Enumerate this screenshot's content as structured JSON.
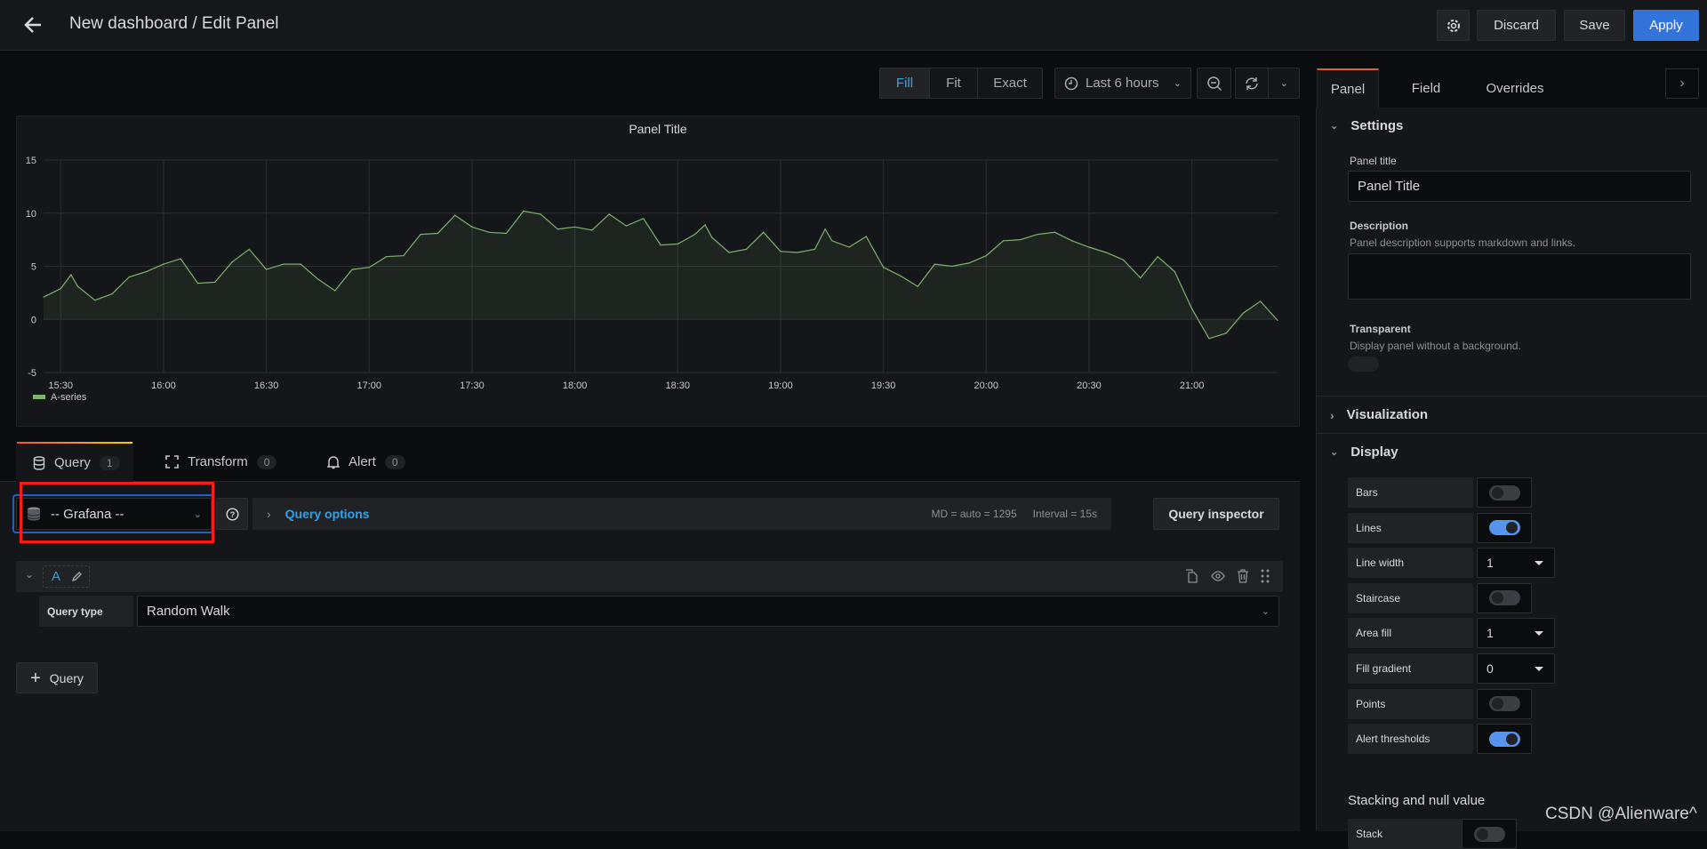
{
  "header": {
    "title": "New dashboard / Edit Panel",
    "discard": "Discard",
    "save": "Save",
    "apply": "Apply"
  },
  "toolbar": {
    "fill": "Fill",
    "fit": "Fit",
    "exact": "Exact",
    "time_range": "Last 6 hours",
    "active_mode": "Fill"
  },
  "panel": {
    "title": "Panel Title",
    "legend": "A-series"
  },
  "chart_data": {
    "type": "area",
    "title": "Panel Title",
    "ylim": [
      -5,
      15
    ],
    "y_ticks": [
      "15",
      "10",
      "5",
      "0",
      "-5"
    ],
    "x_ticks": [
      "15:30",
      "16:00",
      "16:30",
      "17:00",
      "17:30",
      "18:00",
      "18:30",
      "19:00",
      "19:30",
      "20:00",
      "20:30",
      "21:00"
    ],
    "x_range": [
      "15:25",
      "21:25"
    ],
    "grid": true,
    "legend": "bottom-left",
    "series": [
      {
        "name": "A-series",
        "color": "#7eb26d",
        "x": [
          "15:25",
          "15:30",
          "15:33",
          "15:35",
          "15:40",
          "15:45",
          "15:50",
          "15:55",
          "16:00",
          "16:05",
          "16:10",
          "16:15",
          "16:20",
          "16:25",
          "16:30",
          "16:35",
          "16:40",
          "16:45",
          "16:50",
          "16:55",
          "17:00",
          "17:05",
          "17:10",
          "17:15",
          "17:20",
          "17:25",
          "17:30",
          "17:35",
          "17:40",
          "17:45",
          "17:50",
          "17:55",
          "18:00",
          "18:05",
          "18:10",
          "18:15",
          "18:20",
          "18:25",
          "18:30",
          "18:35",
          "18:38",
          "18:40",
          "18:45",
          "18:50",
          "18:55",
          "19:00",
          "19:05",
          "19:10",
          "19:13",
          "19:15",
          "19:20",
          "19:25",
          "19:30",
          "19:35",
          "19:40",
          "19:45",
          "19:50",
          "19:55",
          "20:00",
          "20:05",
          "20:10",
          "20:15",
          "20:20",
          "20:25",
          "20:30",
          "20:35",
          "20:40",
          "20:45",
          "20:50",
          "20:55",
          "21:00",
          "21:05",
          "21:10",
          "21:15",
          "21:20",
          "21:25"
        ],
        "values": [
          2.1,
          2.9,
          4.2,
          3.1,
          1.8,
          2.4,
          4.0,
          4.5,
          5.2,
          5.7,
          3.4,
          3.5,
          5.4,
          6.6,
          4.7,
          5.2,
          5.2,
          3.8,
          2.7,
          4.7,
          4.9,
          5.9,
          6.0,
          8.0,
          8.1,
          9.8,
          8.7,
          8.2,
          8.1,
          10.2,
          9.9,
          8.5,
          8.7,
          8.4,
          9.9,
          8.8,
          9.5,
          7.0,
          7.1,
          8.0,
          8.9,
          7.7,
          6.3,
          6.6,
          8.2,
          6.4,
          6.3,
          6.6,
          8.5,
          7.4,
          6.8,
          7.8,
          4.9,
          4.1,
          3.1,
          5.2,
          5.0,
          5.3,
          6.0,
          7.4,
          7.5,
          8.0,
          8.2,
          7.4,
          6.8,
          6.3,
          5.6,
          3.9,
          5.9,
          4.5,
          1.0,
          -1.8,
          -1.3,
          0.6,
          1.7,
          -0.1
        ]
      }
    ]
  },
  "query_tabs": [
    {
      "label": "Query",
      "count": "1"
    },
    {
      "label": "Transform",
      "count": "0"
    },
    {
      "label": "Alert",
      "count": "0"
    }
  ],
  "datasource": {
    "value": "-- Grafana --"
  },
  "query_options": {
    "label": "Query options",
    "md": "MD = auto = 1295",
    "interval": "Interval = 15s"
  },
  "query_inspector": "Query inspector",
  "query": {
    "ref": "A",
    "type_label": "Query type",
    "type_value": "Random Walk"
  },
  "add_query": "Query",
  "options_tabs": [
    "Panel",
    "Field",
    "Overrides"
  ],
  "settings": {
    "heading": "Settings",
    "title_label": "Panel title",
    "title_value": "Panel Title",
    "desc_label": "Description",
    "desc_help": "Panel description supports markdown and links.",
    "transparent_label": "Transparent",
    "transparent_help": "Display panel without a background.",
    "transparent_on": false
  },
  "visualization": {
    "heading": "Visualization"
  },
  "display": {
    "heading": "Display",
    "rows": [
      {
        "label": "Bars",
        "kind": "toggle",
        "on": false
      },
      {
        "label": "Lines",
        "kind": "toggle",
        "on": true
      },
      {
        "label": "Line width",
        "kind": "select",
        "value": "1"
      },
      {
        "label": "Staircase",
        "kind": "toggle",
        "on": false
      },
      {
        "label": "Area fill",
        "kind": "select",
        "value": "1"
      },
      {
        "label": "Fill gradient",
        "kind": "select",
        "value": "0"
      },
      {
        "label": "Points",
        "kind": "toggle",
        "on": false
      },
      {
        "label": "Alert thresholds",
        "kind": "toggle",
        "on": true
      }
    ]
  },
  "stacking": {
    "heading": "Stacking and null value",
    "stack_label": "Stack"
  },
  "watermark": "CSDN @Alienware^",
  "colors": {
    "accent": "#3274d9",
    "link": "#33a2e5",
    "series": "#7eb26d",
    "annotation": "#ff0000"
  }
}
